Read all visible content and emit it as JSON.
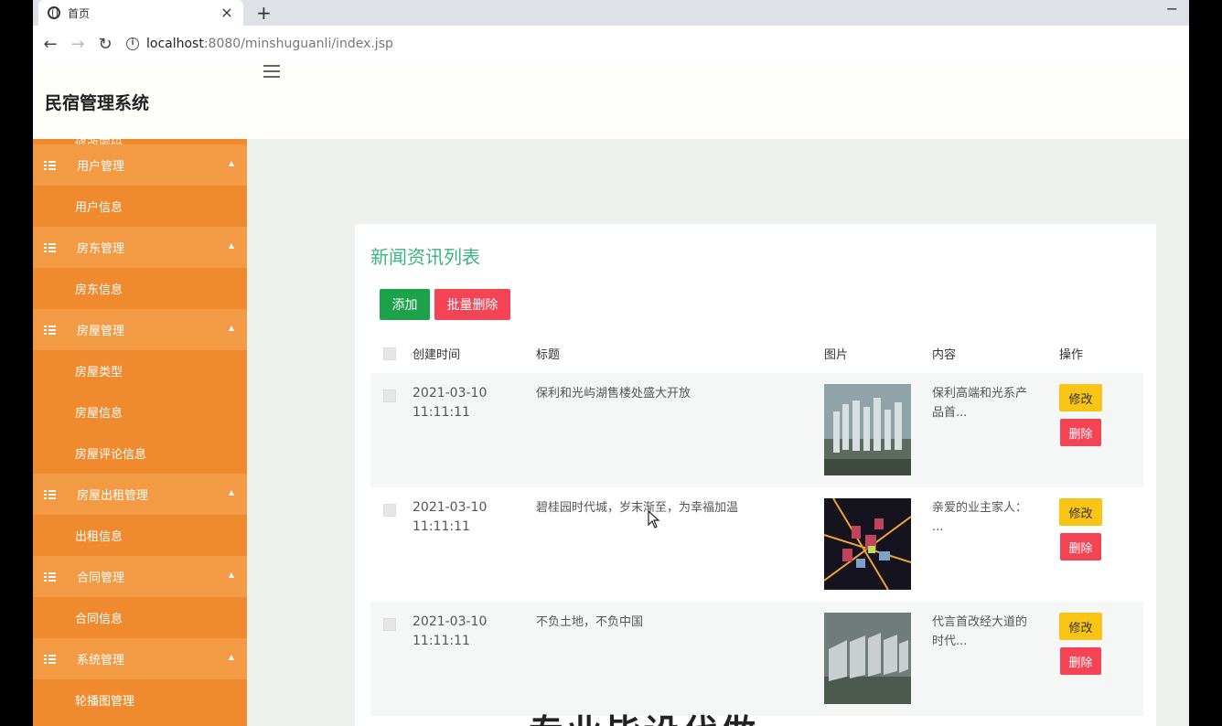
{
  "browser": {
    "tab_title": "首页",
    "tab_close": "×",
    "new_tab": "+",
    "minimize": "−",
    "url_host": "localhost",
    "url_rest": ":8080/minshuguanli/index.jsp"
  },
  "header": {
    "title": "民宿管理系统"
  },
  "sidebar": {
    "partial_item": "修改密码",
    "items": [
      {
        "type": "group",
        "label": "用户管理"
      },
      {
        "type": "child",
        "label": "用户信息"
      },
      {
        "type": "group",
        "label": "房东管理"
      },
      {
        "type": "child",
        "label": "房东信息"
      },
      {
        "type": "group",
        "label": "房屋管理"
      },
      {
        "type": "child",
        "label": "房屋类型"
      },
      {
        "type": "child",
        "label": "房屋信息"
      },
      {
        "type": "child",
        "label": "房屋评论信息"
      },
      {
        "type": "group",
        "label": "房屋出租管理"
      },
      {
        "type": "child",
        "label": "出租信息"
      },
      {
        "type": "group",
        "label": "合同管理"
      },
      {
        "type": "child",
        "label": "合同信息"
      },
      {
        "type": "group",
        "label": "系统管理"
      },
      {
        "type": "child",
        "label": "轮播图管理"
      }
    ]
  },
  "main": {
    "card_title": "新闻资讯列表",
    "add_label": "添加",
    "bulk_delete_label": "批量删除",
    "columns": {
      "created": "创建时间",
      "title": "标题",
      "image": "图片",
      "content": "内容",
      "actions": "操作"
    },
    "edit_label": "修改",
    "delete_label": "删除",
    "rows": [
      {
        "date": "2021-03-10",
        "time": "11:11:11",
        "title": "保利和光屿湖售楼处盛大开放",
        "content_1": "保利高端和光系产",
        "content_2": "品首..."
      },
      {
        "date": "2021-03-10",
        "time": "11:11:11",
        "title": "碧桂园时代城，岁末渐至，为幸福加温",
        "content_1": "亲爱的业主家人：",
        "content_2": "..."
      },
      {
        "date": "2021-03-10",
        "time": "11:11:11",
        "title": "不负土地，不负中国",
        "content_1": "代言首改经大道的",
        "content_2": "时代..."
      }
    ],
    "overlay_text": "专业毕设代做"
  },
  "colors": {
    "sidebar": "#f08a2e",
    "accent_title": "#3bb47f",
    "add_button": "#1ba24a",
    "delete_button": "#f44355",
    "edit_button": "#f8c416"
  }
}
